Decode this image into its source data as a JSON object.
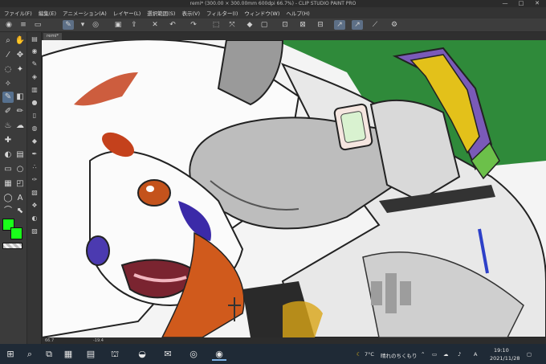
{
  "window": {
    "title": "remi* (300.00 × 300.00mm 600dpi 66.7%) - CLIP STUDIO PAINT PRO",
    "minimize": "—",
    "maximize": "□",
    "close": "✕"
  },
  "menu": [
    "ファイル(F)",
    "編集(E)",
    "アニメーション(A)",
    "レイヤー(L)",
    "選択範囲(S)",
    "表示(V)",
    "フィルター(I)",
    "ウィンドウ(W)",
    "ヘルプ(H)"
  ],
  "canvas": {
    "tab_label": "remi*",
    "zoom": "66.7",
    "angle": "-19.4"
  },
  "colors": {
    "main": "#1aff1a",
    "sub": "#1aff1a",
    "accent": "#56708e",
    "background_green": "#2f8a3a"
  },
  "taskbar": {
    "weather_temp": "7°C",
    "weather_text": "晴れのちくもり",
    "ime": "A",
    "time": "19:10",
    "date": "2021/11/28"
  }
}
